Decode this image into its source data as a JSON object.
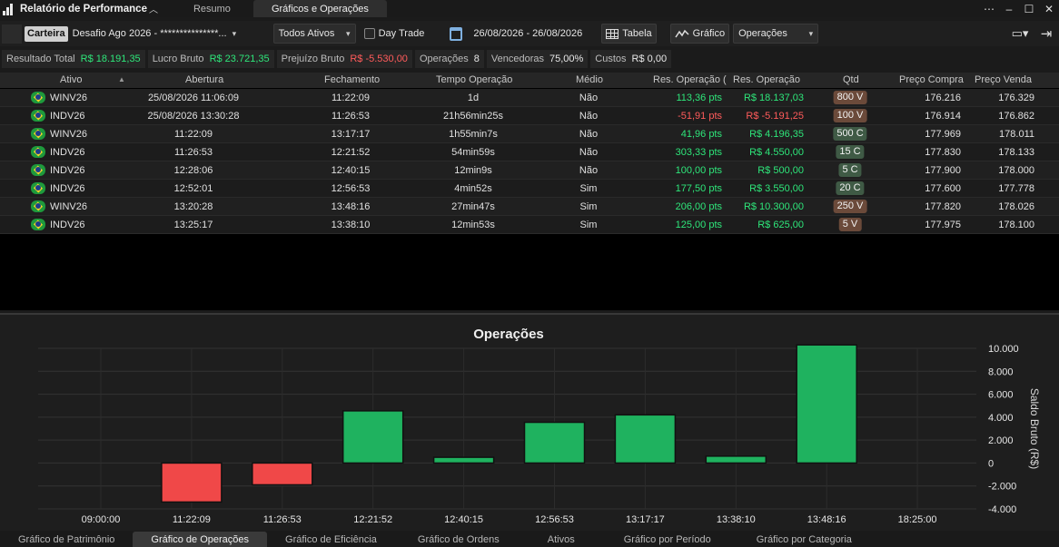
{
  "titlebar": {
    "app_title": "Relatório de Performance",
    "tabs": [
      {
        "label": "Resumo",
        "active": false
      },
      {
        "label": "Gráficos e Operações",
        "active": true
      }
    ]
  },
  "toolbar": {
    "carteira_label": "Carteira",
    "account_value": "Desafio Ago 2026 - ***************...",
    "assets_value": "Todos Ativos",
    "daytrade_label": "Day Trade",
    "daytrade_checked": false,
    "date_range": "26/08/2026 - 26/08/2026",
    "table_label": "Tabela",
    "chart_label": "Gráfico",
    "chart_type_value": "Operações"
  },
  "summary": [
    {
      "label": "Resultado Total",
      "value": "R$ 18.191,35",
      "tone": "pos"
    },
    {
      "label": "Lucro Bruto",
      "value": "R$ 23.721,35",
      "tone": "pos"
    },
    {
      "label": "Prejuízo Bruto",
      "value": "R$ -5.530,00",
      "tone": "neg"
    },
    {
      "label": "Operações",
      "value": "8",
      "tone": ""
    },
    {
      "label": "Vencedoras",
      "value": "75,00%",
      "tone": ""
    },
    {
      "label": "Custos",
      "value": "R$ 0,00",
      "tone": ""
    }
  ],
  "table": {
    "columns": [
      "Ativo",
      "Abertura",
      "Fechamento",
      "Tempo Operação",
      "Médio",
      "Res. Operação (",
      "Res. Operação",
      "Qtd",
      "Preço Compra",
      "Preço Venda"
    ],
    "rows": [
      {
        "ativo": "WINV26",
        "abertura": "25/08/2026 11:06:09",
        "fechamento": "11:22:09",
        "tempo": "1d",
        "medio": "Não",
        "res_pts": "113,36 pts",
        "res_rs": "R$ 18.137,03",
        "tone": "pos",
        "qtd": "800 V",
        "side": "v",
        "compra": "176.216",
        "venda": "176.329"
      },
      {
        "ativo": "INDV26",
        "abertura": "25/08/2026 13:30:28",
        "fechamento": "11:26:53",
        "tempo": "21h56min25s",
        "medio": "Não",
        "res_pts": "-51,91 pts",
        "res_rs": "R$ -5.191,25",
        "tone": "neg",
        "qtd": "100 V",
        "side": "v",
        "compra": "176.914",
        "venda": "176.862"
      },
      {
        "ativo": "WINV26",
        "abertura": "11:22:09",
        "fechamento": "13:17:17",
        "tempo": "1h55min7s",
        "medio": "Não",
        "res_pts": "41,96 pts",
        "res_rs": "R$ 4.196,35",
        "tone": "pos",
        "qtd": "500 C",
        "side": "c",
        "compra": "177.969",
        "venda": "178.011"
      },
      {
        "ativo": "INDV26",
        "abertura": "11:26:53",
        "fechamento": "12:21:52",
        "tempo": "54min59s",
        "medio": "Não",
        "res_pts": "303,33 pts",
        "res_rs": "R$ 4.550,00",
        "tone": "pos",
        "qtd": "15 C",
        "side": "c",
        "compra": "177.830",
        "venda": "178.133"
      },
      {
        "ativo": "INDV26",
        "abertura": "12:28:06",
        "fechamento": "12:40:15",
        "tempo": "12min9s",
        "medio": "Não",
        "res_pts": "100,00 pts",
        "res_rs": "R$ 500,00",
        "tone": "pos",
        "qtd": "5 C",
        "side": "c",
        "compra": "177.900",
        "venda": "178.000"
      },
      {
        "ativo": "INDV26",
        "abertura": "12:52:01",
        "fechamento": "12:56:53",
        "tempo": "4min52s",
        "medio": "Sim",
        "res_pts": "177,50 pts",
        "res_rs": "R$ 3.550,00",
        "tone": "pos",
        "qtd": "20 C",
        "side": "c",
        "compra": "177.600",
        "venda": "177.778"
      },
      {
        "ativo": "WINV26",
        "abertura": "13:20:28",
        "fechamento": "13:48:16",
        "tempo": "27min47s",
        "medio": "Sim",
        "res_pts": "206,00 pts",
        "res_rs": "R$ 10.300,00",
        "tone": "pos",
        "qtd": "250 V",
        "side": "v",
        "compra": "177.820",
        "venda": "178.026"
      },
      {
        "ativo": "INDV26",
        "abertura": "13:25:17",
        "fechamento": "13:38:10",
        "tempo": "12min53s",
        "medio": "Sim",
        "res_pts": "125,00 pts",
        "res_rs": "R$ 625,00",
        "tone": "pos",
        "qtd": "5 V",
        "side": "v",
        "compra": "177.975",
        "venda": "178.100"
      }
    ]
  },
  "chart_data": {
    "type": "bar",
    "title": "Operações",
    "xlabel": "",
    "ylabel": "Saldo Bruto (R$)",
    "x_ticks": [
      "09:00:00",
      "11:22:09",
      "11:26:53",
      "12:21:52",
      "12:40:15",
      "12:56:53",
      "13:17:17",
      "13:38:10",
      "13:48:16",
      "18:25:00"
    ],
    "categories": [
      "11:22:09",
      "11:26:53",
      "12:21:52",
      "12:40:15",
      "12:56:53",
      "13:17:17",
      "13:38:10",
      "13:48:16"
    ],
    "values": [
      -3400,
      -1900,
      4550,
      500,
      3550,
      4200,
      600,
      10300
    ],
    "ylim": [
      -4000,
      10000
    ],
    "y_ticks": [
      "-4.000",
      "-2.000",
      "0",
      "2.000",
      "4.000",
      "6.000",
      "8.000",
      "10.000"
    ],
    "y_tick_values": [
      -4000,
      -2000,
      0,
      2000,
      4000,
      6000,
      8000,
      10000
    ],
    "grid": true,
    "colors": {
      "positive": "#1fb25f",
      "negative": "#f04848"
    }
  },
  "bottom_tabs": [
    {
      "label": "Gráfico de Patrimônio",
      "active": false
    },
    {
      "label": "Gráfico de Operações",
      "active": true
    },
    {
      "label": "Gráfico de Eficiência",
      "active": false
    },
    {
      "label": "Gráfico de Ordens",
      "active": false
    },
    {
      "label": "Ativos",
      "active": false
    },
    {
      "label": "Gráfico por Período",
      "active": false
    },
    {
      "label": "Gráfico por Categoria",
      "active": false
    }
  ]
}
